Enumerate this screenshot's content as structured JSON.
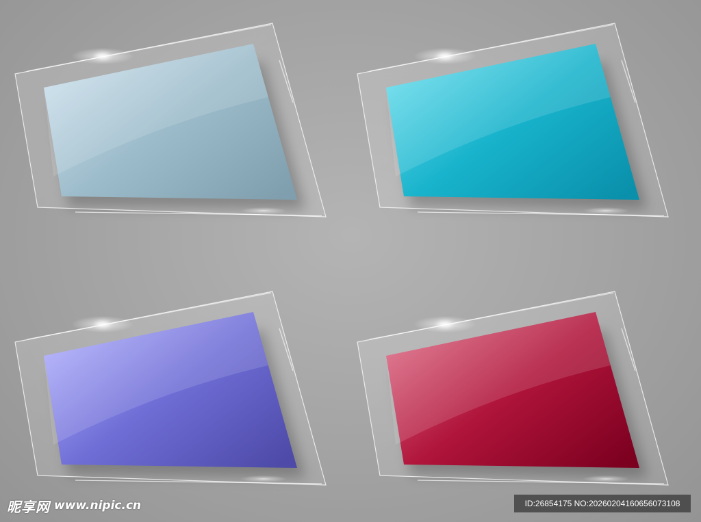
{
  "panels": [
    {
      "name": "light-blue",
      "color_light": "#cfe3ee",
      "color_mid": "#9dbccb",
      "color_dark": "#7f9fae"
    },
    {
      "name": "cyan",
      "color_light": "#6fe0ef",
      "color_mid": "#18b3cc",
      "color_dark": "#0a90ab"
    },
    {
      "name": "purple",
      "color_light": "#b4b3ff",
      "color_mid": "#6f6ed6",
      "color_dark": "#4d4aa8"
    },
    {
      "name": "crimson",
      "color_light": "#e0708a",
      "color_mid": "#b0143a",
      "color_dark": "#7c0020"
    }
  ],
  "watermark": {
    "logo_text": "昵享网",
    "url_text": "www.nipic.cn",
    "id_text": "ID:26854175 NO:20260204160656073108"
  }
}
